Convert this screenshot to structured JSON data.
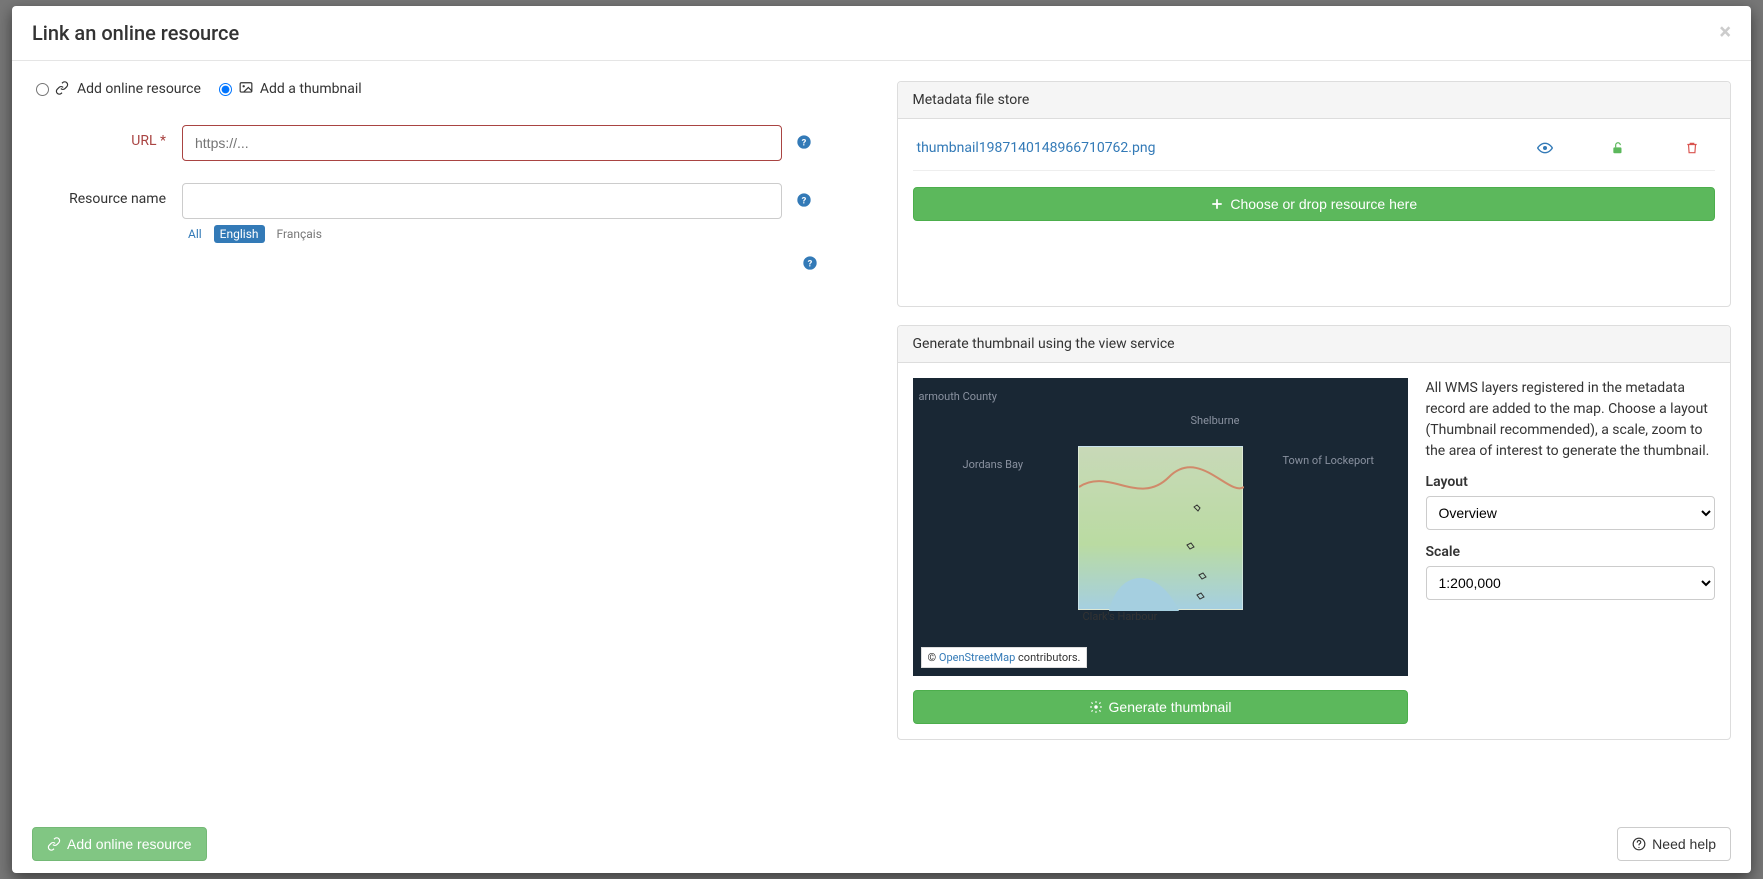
{
  "modal": {
    "title": "Link an online resource",
    "close_glyph": "×"
  },
  "radios": {
    "online_resource": "Add online resource",
    "thumbnail": "Add a thumbnail"
  },
  "form": {
    "url_label": "URL *",
    "url_placeholder": "https://...",
    "resource_name_label": "Resource name",
    "lang_all": "All",
    "lang_en": "English",
    "lang_fr": "Français"
  },
  "filestore": {
    "heading": "Metadata file store",
    "file_name": "thumbnail1987140148966710762.png",
    "drop_label": "Choose or drop resource here"
  },
  "thumbgen": {
    "heading": "Generate thumbnail using the view service",
    "desc": "All WMS layers registered in the metadata record are added to the map. Choose a layout (Thumbnail recommended), a scale, zoom to the area of interest to generate the thumbnail.",
    "layout_label": "Layout",
    "layout_value": "Overview",
    "scale_label": "Scale",
    "scale_value": "1:200,000",
    "generate_label": "Generate thumbnail",
    "attr_prefix": "© ",
    "attr_link": "OpenStreetMap",
    "attr_suffix": " contributors.",
    "map_labels": {
      "yarmouth": "armouth County",
      "jordans": "Jordans Bay",
      "shelburne": "Shelburne",
      "lockeport": "Town of Lockeport",
      "clark": "Clark's Harbour"
    }
  },
  "footer": {
    "add_label": "Add online resource",
    "need_help": "Need help"
  }
}
